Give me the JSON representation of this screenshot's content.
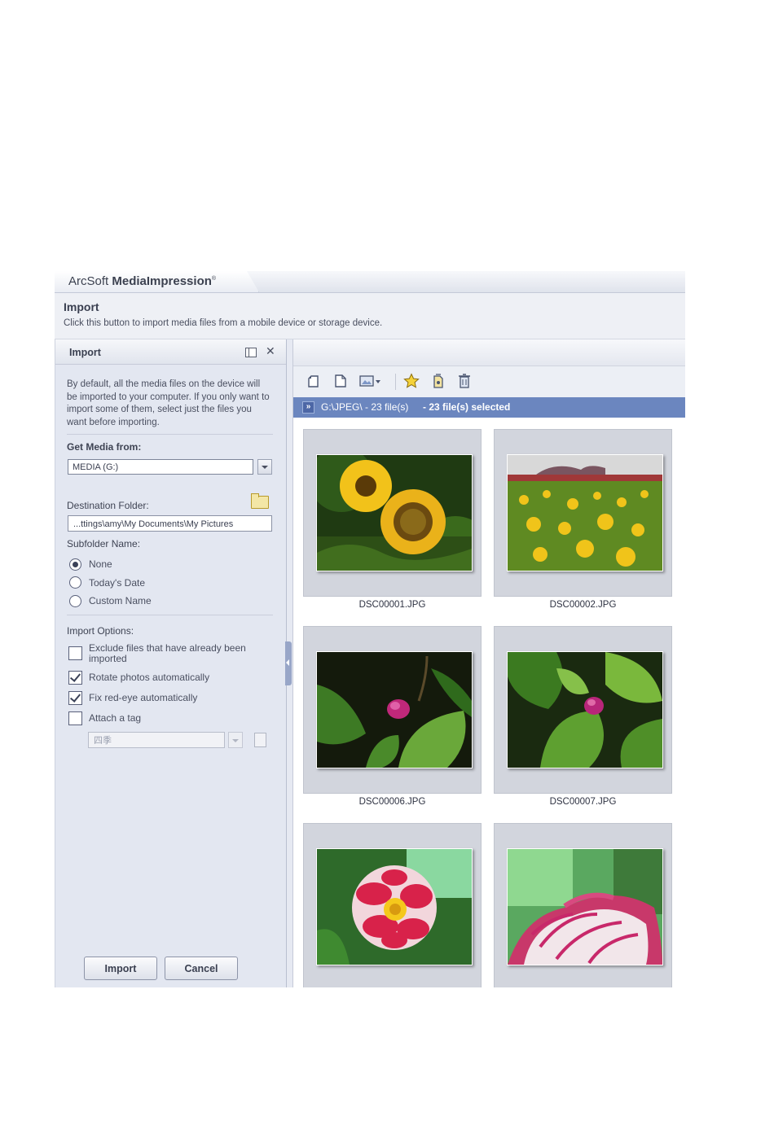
{
  "app": {
    "title_prefix": "ArcSoft ",
    "title_bold": "MediaImpression",
    "title_mark": "®"
  },
  "header": {
    "title": "Import",
    "description": "Click this button to import media files from a mobile device or storage device."
  },
  "panel": {
    "title": "Import",
    "description": "By default, all the media files on the device will be imported to your computer. If you only want to import some of them, select just the files you want before importing.",
    "get_media_label": "Get Media from:",
    "media_source": "MEDIA (G:)",
    "destination_label": "Destination Folder:",
    "destination_value": "...ttings\\amy\\My Documents\\My Pictures",
    "subfolder_label": "Subfolder Name:",
    "subfolder_options": [
      {
        "label": "None",
        "selected": true
      },
      {
        "label": "Today's Date",
        "selected": false
      },
      {
        "label": "Custom Name",
        "selected": false
      }
    ],
    "import_options_label": "Import Options:",
    "options": [
      {
        "label": "Exclude files that have already been imported",
        "checked": false
      },
      {
        "label": "Rotate photos automatically",
        "checked": true
      },
      {
        "label": "Fix red-eye automatically",
        "checked": true
      },
      {
        "label": "Attach a tag",
        "checked": false
      }
    ],
    "tag_value": "四季",
    "import_button": "Import",
    "cancel_button": "Cancel"
  },
  "browser": {
    "path": "G:\\JPEG\\ - 23 file(s)",
    "selection": "- 23 file(s) selected",
    "thumbnails": [
      {
        "name": "DSC00001.JPG",
        "subject": "sunflower close-up"
      },
      {
        "name": "DSC00002.JPG",
        "subject": "sunflower field"
      },
      {
        "name": "DSC00006.JPG",
        "subject": "pink flower bud"
      },
      {
        "name": "DSC00007.JPG",
        "subject": "pink flower bud with leaves"
      },
      {
        "name": "",
        "subject": "red and white peony"
      },
      {
        "name": "",
        "subject": "pink and white peony"
      }
    ],
    "toolbar_icons": [
      "rotate-left-icon",
      "rotate-right-icon",
      "view-mode-icon",
      "rating-star-icon",
      "tag-icon",
      "delete-icon"
    ]
  },
  "colors": {
    "accent": "#6b86bf",
    "panel_bg": "#e3e7f1"
  }
}
